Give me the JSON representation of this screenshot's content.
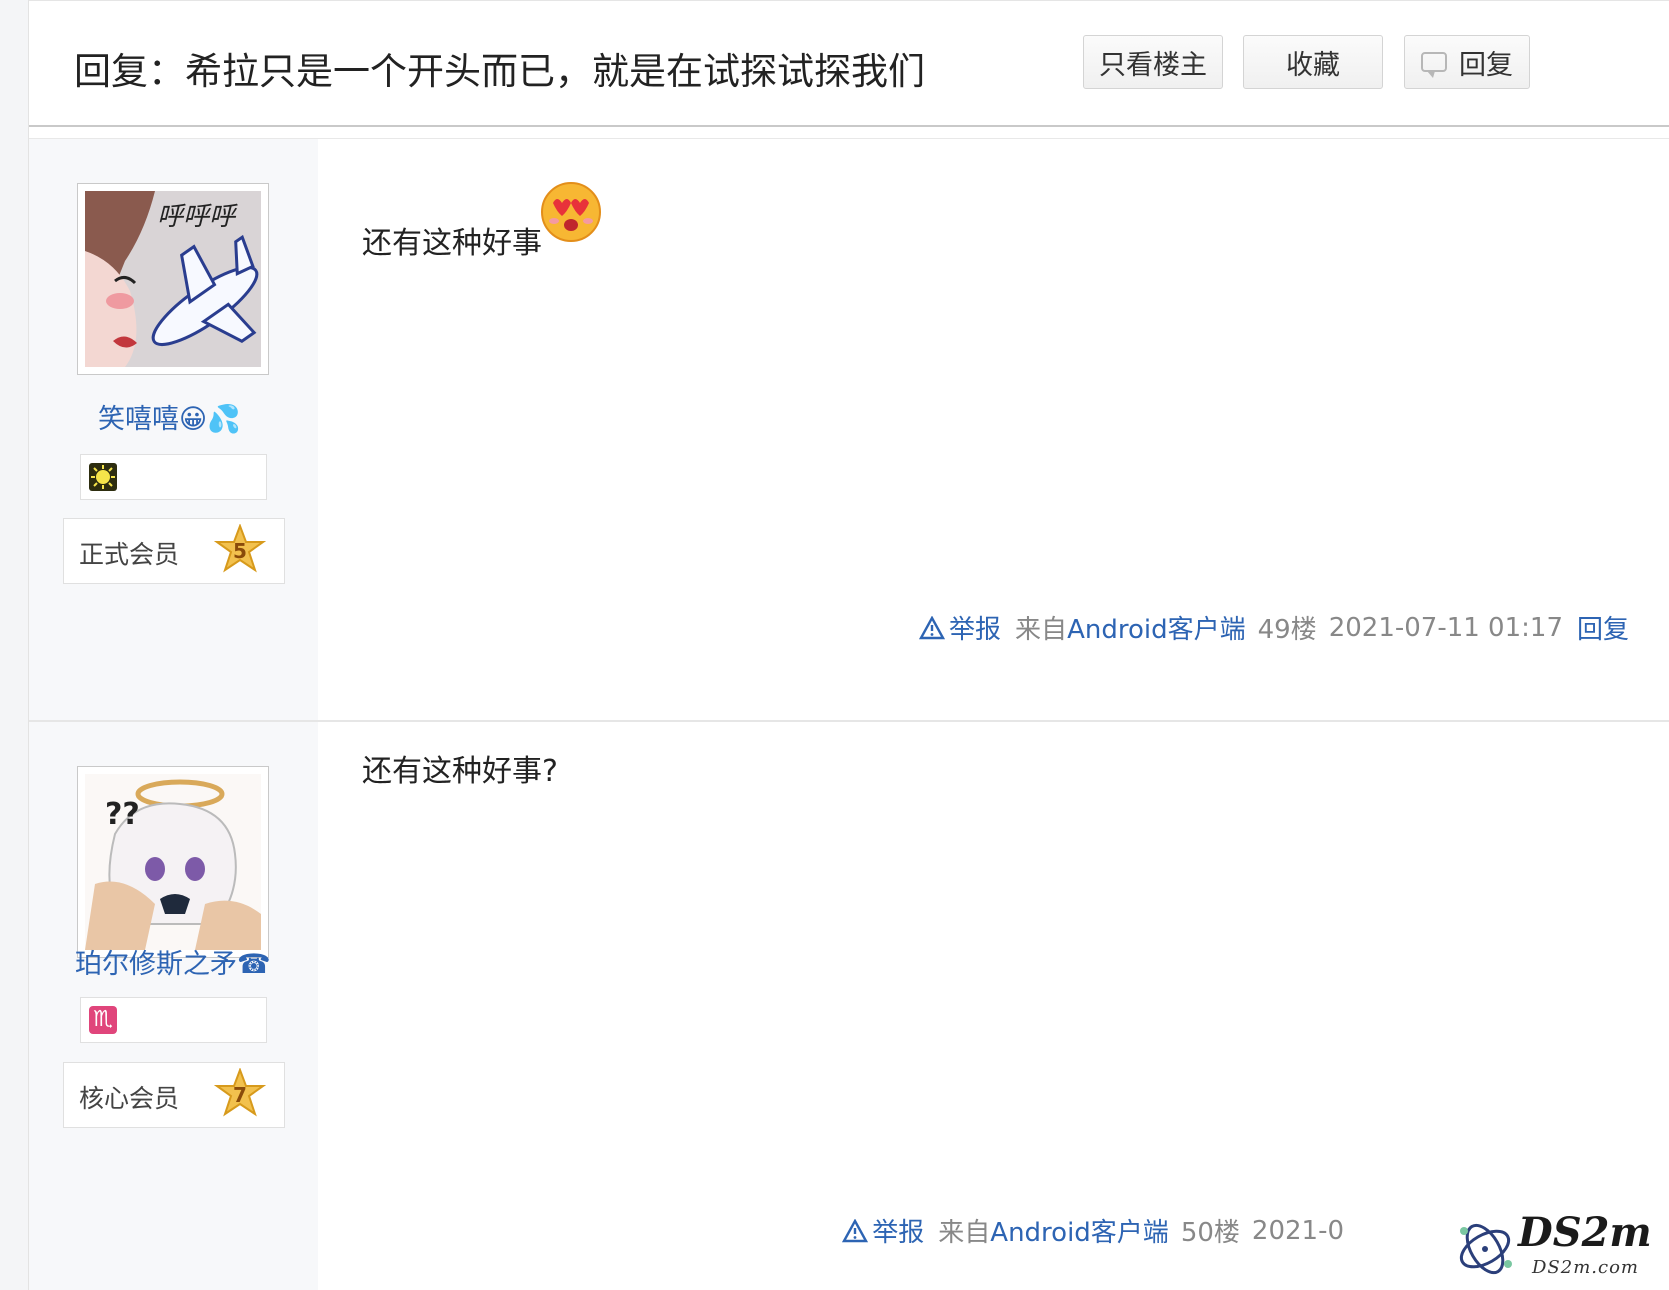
{
  "header": {
    "title": "回复：希拉只是一个开头而已，就是在试探试探我们",
    "only_op_label": "只看楼主",
    "favorite_label": "收藏",
    "reply_label": "回复"
  },
  "posts": [
    {
      "username": "笑嘻嘻😀💦",
      "avatar_icon": "anime-girl-airplane-avatar",
      "avatar_caption": "呼呼呼",
      "badge_icon": "sun-badge-icon",
      "rank_label": "正式会员",
      "rank_level": "5",
      "content": "还有这种好事",
      "emoji_icon": "heart-eyes-emoji-icon",
      "report_label": "举报",
      "client_prefix": "来自",
      "client_name": "Android客户端",
      "floor": "49楼",
      "time": "2021-07-11 01:17",
      "reply_label": "回复"
    },
    {
      "username": "珀尔修斯之矛☎",
      "avatar_icon": "confused-chibi-avatar",
      "avatar_caption": "??",
      "badge_icon": "scorpio-badge-icon",
      "badge_glyph": "♏",
      "rank_label": "核心会员",
      "rank_level": "7",
      "content": "还有这种好事?",
      "report_label": "举报",
      "client_prefix": "来自",
      "client_name": "Android客户端",
      "floor": "50楼",
      "time": "2021-0"
    }
  ],
  "watermark": {
    "brand": "DS2m",
    "domain": "DS2m.com"
  },
  "colors": {
    "link": "#2d64b3",
    "meta": "#888888",
    "side_bg": "#f7f8fa",
    "badge_scorpio": "#e0457b",
    "star_gold": "#f2c14e"
  }
}
